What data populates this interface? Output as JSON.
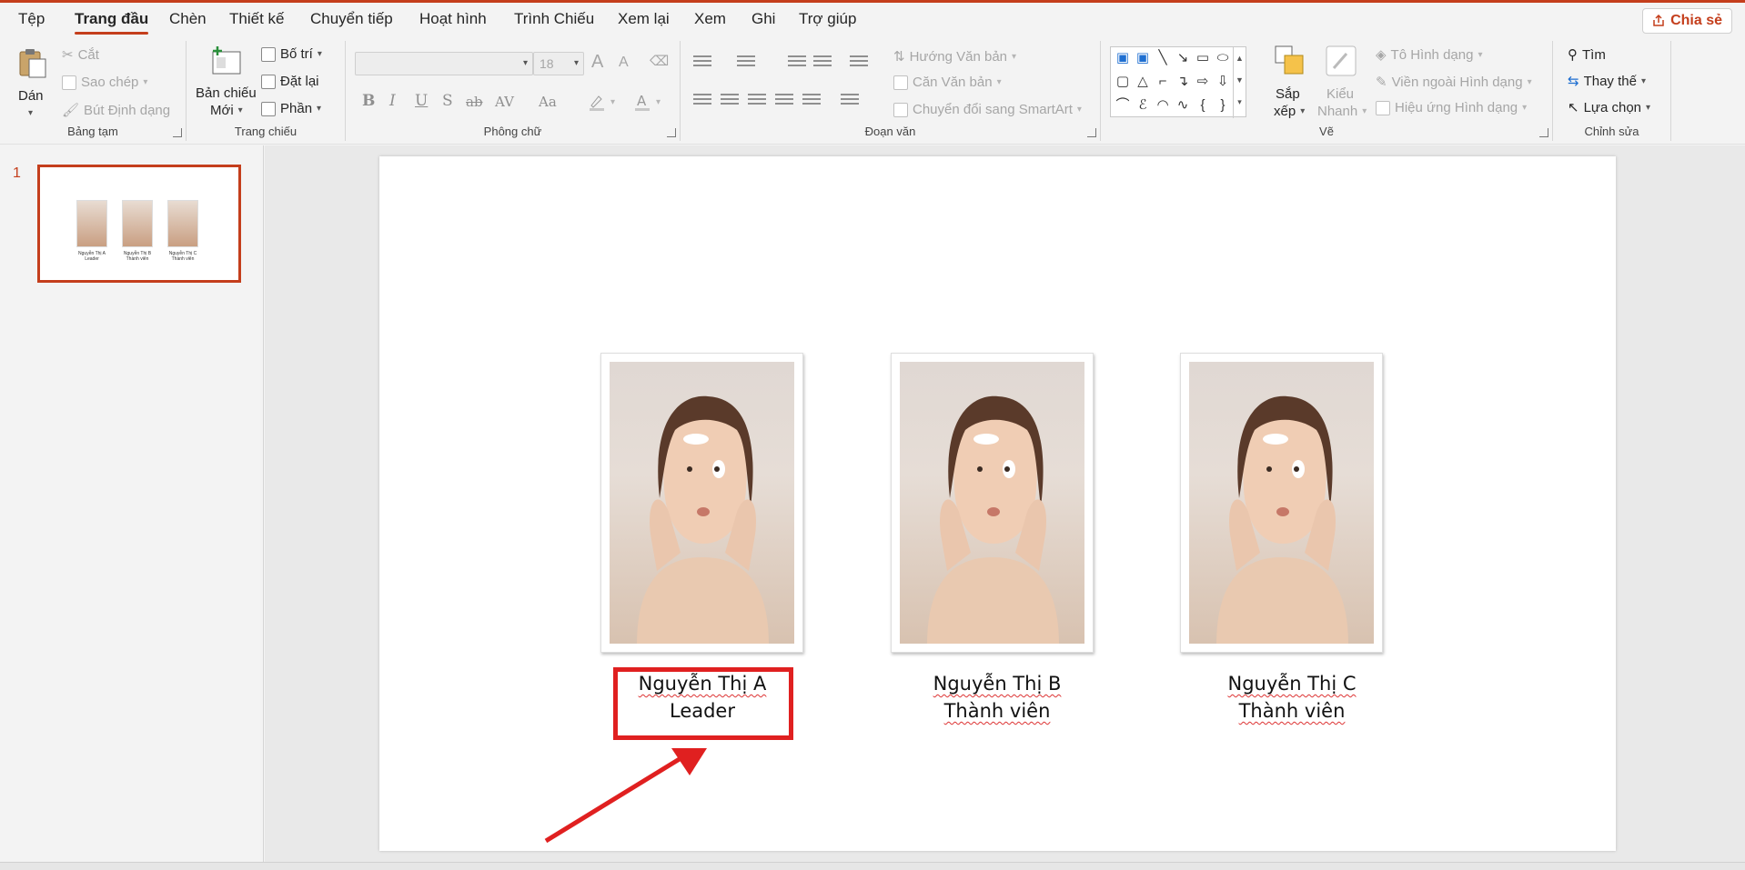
{
  "menu": {
    "tabs": [
      "Tệp",
      "Trang đầu",
      "Chèn",
      "Thiết kế",
      "Chuyển tiếp",
      "Hoạt hình",
      "Trình Chiếu",
      "Xem lại",
      "Xem",
      "Ghi",
      "Trợ giúp"
    ],
    "active_tab": "Trang đầu",
    "share_label": "Chia sẻ"
  },
  "ribbon": {
    "clipboard": {
      "label": "Bảng tạm",
      "paste": "Dán",
      "cut": "Cắt",
      "copy": "Sao chép",
      "format_painter": "Bút Định dạng"
    },
    "slides": {
      "label": "Trang chiếu",
      "new_slide_1": "Bản chiếu",
      "new_slide_2": "Mới",
      "layout": "Bố trí",
      "reset": "Đặt lại",
      "section": "Phần"
    },
    "font": {
      "label": "Phông chữ",
      "font_name": "",
      "font_size": "18",
      "bold": "B",
      "italic": "I",
      "underline": "U",
      "shadow": "S",
      "strike": "ab",
      "spacing": "AV",
      "case": "Aa",
      "grow": "A",
      "shrink": "A"
    },
    "paragraph": {
      "label": "Đoạn văn",
      "text_direction": "Hướng Văn bản",
      "align_text": "Căn Văn bản",
      "smartart": "Chuyển đổi sang SmartArt"
    },
    "drawing": {
      "label": "Vẽ",
      "arrange_1": "Sắp",
      "arrange_2": "xếp",
      "quick_styles_1": "Kiểu",
      "quick_styles_2": "Nhanh",
      "shape_fill": "Tô Hình dạng",
      "shape_outline": "Viền ngoài Hình dạng",
      "shape_effects": "Hiệu ứng Hình dạng"
    },
    "editing": {
      "label": "Chỉnh sửa",
      "find": "Tìm",
      "replace": "Thay thế",
      "select": "Lựa chọn"
    }
  },
  "thumbnails": {
    "slide_number": "1",
    "captions": [
      [
        "Nguyễn Thị A",
        "Leader"
      ],
      [
        "Nguyễn Thị B",
        "Thành viên"
      ],
      [
        "Nguyễn Thị C",
        "Thành viên"
      ]
    ]
  },
  "slide": {
    "cards": [
      {
        "name": "Nguyễn Thị A",
        "role": "Leader"
      },
      {
        "name": "Nguyễn Thị B",
        "role": "Thành viên"
      },
      {
        "name": "Nguyễn Thị C",
        "role": "Thành viên"
      }
    ]
  },
  "colors": {
    "accent": "#c43e1c",
    "highlight": "#e02020"
  }
}
